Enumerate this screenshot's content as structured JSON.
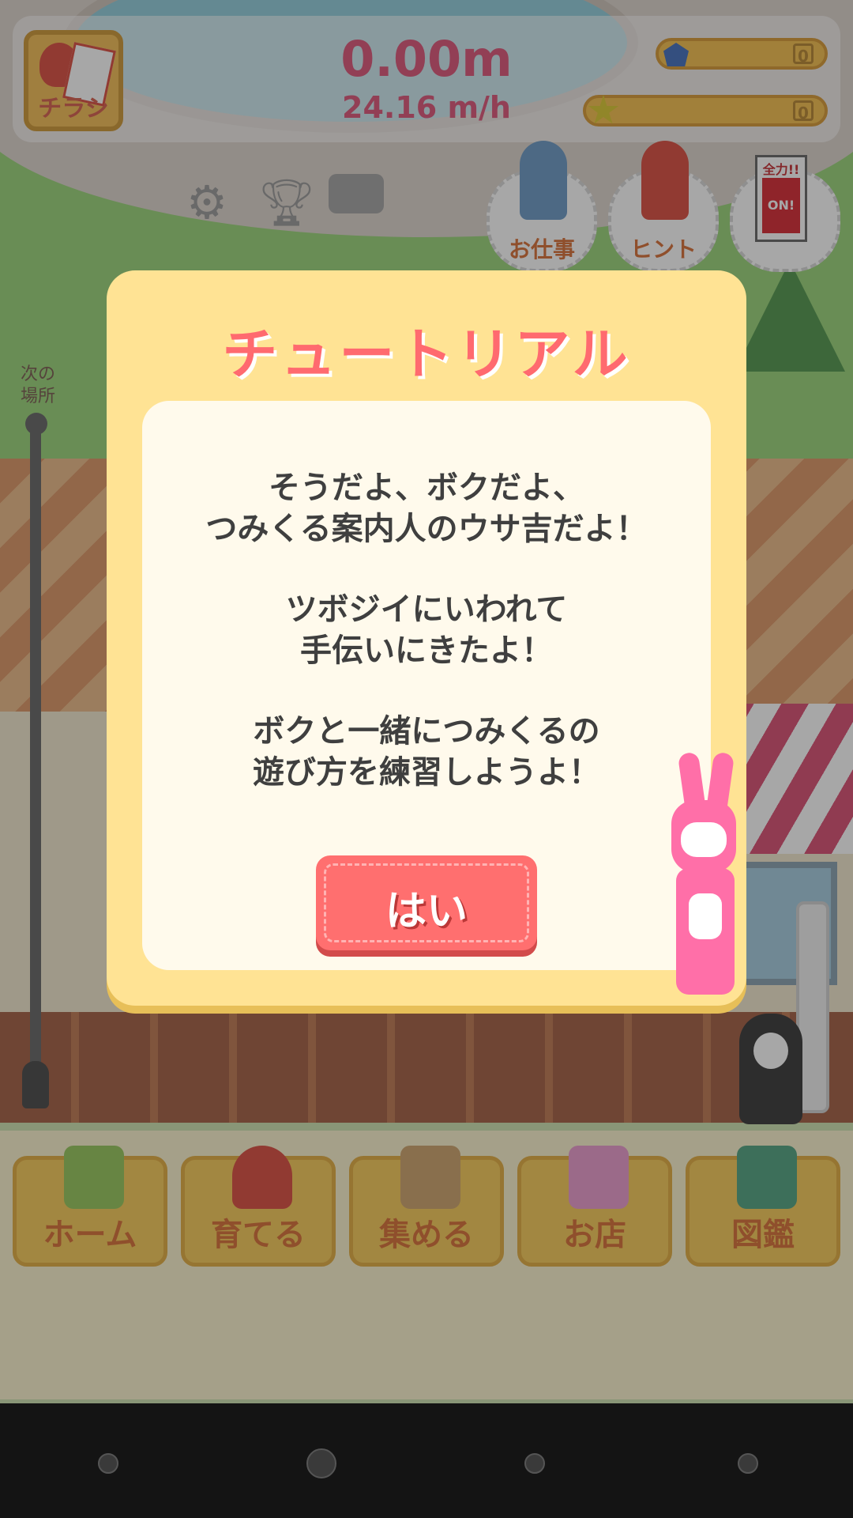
{
  "hud": {
    "flyer_label": "チラシ",
    "distance": "0.00m",
    "speed": "24.16 m/h",
    "gems": "0",
    "stars": "0"
  },
  "toolbar_icons": [
    "gear-icon",
    "trophy-icon",
    "camera-icon"
  ],
  "side_buttons": {
    "job_label": "お仕事",
    "hint_label": "ヒント",
    "full_power_label": "全力!!",
    "full_power_switch": "ON!"
  },
  "progress": {
    "next_place_label_1": "次の",
    "next_place_label_2": "場所"
  },
  "modal": {
    "title": "チュートリアル",
    "lines": [
      "そうだよ、ボクだよ、",
      "つみくる案内人のウサ吉だよ！",
      "ツボジイにいわれて",
      "手伝いにきたよ！",
      "ボクと一緒につみくるの",
      "遊び方を練習しようよ！"
    ],
    "yes_button": "はい"
  },
  "nav": {
    "items": [
      {
        "label": "ホーム"
      },
      {
        "label": "育てる"
      },
      {
        "label": "集める"
      },
      {
        "label": "お店"
      },
      {
        "label": "図鑑"
      }
    ]
  },
  "colors": {
    "accent_pink": "#ff6a6f",
    "hud_text": "#d9426a",
    "nav_button": "#f6c545",
    "modal_bg": "#ffe394"
  }
}
